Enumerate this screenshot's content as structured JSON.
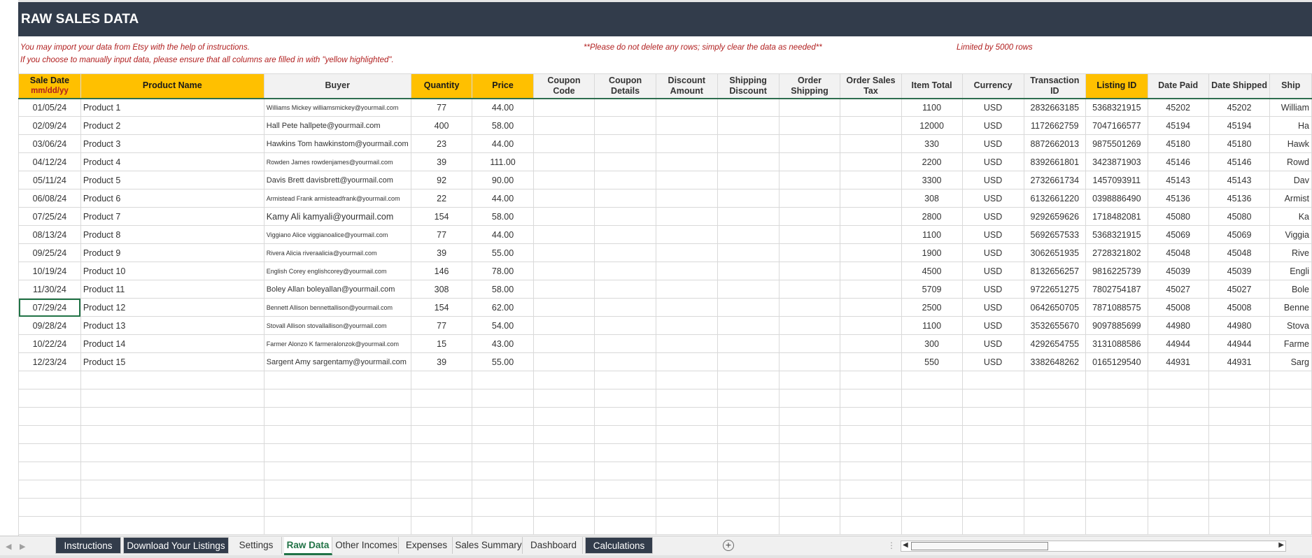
{
  "title": "RAW SALES DATA",
  "notes": {
    "line1": "You may import your data from Etsy with the help of instructions.",
    "line2": "If you choose to manually input data, please ensure that all columns are filled in with \"yellow highlighted\".",
    "warning": "**Please do not delete any rows; simply clear the data as needed**",
    "limit": "Limited by 5000 rows"
  },
  "columns": [
    {
      "label": "Sale Date",
      "sub": "mm/dd/yy",
      "yellow": true
    },
    {
      "label": "Product Name",
      "yellow": true
    },
    {
      "label": "Buyer",
      "yellow": false
    },
    {
      "label": "Quantity",
      "yellow": true
    },
    {
      "label": "Price",
      "yellow": true
    },
    {
      "label": "Coupon Code",
      "yellow": false
    },
    {
      "label": "Coupon Details",
      "yellow": false
    },
    {
      "label": "Discount Amount",
      "yellow": false
    },
    {
      "label": "Shipping Discount",
      "yellow": false
    },
    {
      "label": "Order Shipping",
      "yellow": false
    },
    {
      "label": "Order Sales Tax",
      "yellow": false
    },
    {
      "label": "Item Total",
      "yellow": false
    },
    {
      "label": "Currency",
      "yellow": false
    },
    {
      "label": "Transaction ID",
      "yellow": false
    },
    {
      "label": "Listing ID",
      "yellow": true
    },
    {
      "label": "Date Paid",
      "yellow": false
    },
    {
      "label": "Date Shipped",
      "yellow": false
    },
    {
      "label": "Ship",
      "yellow": false
    }
  ],
  "rows": [
    {
      "date": "01/05/24",
      "product": "Product 1",
      "buyer": "Williams Mickey williamsmickey@yourmail.com",
      "qty": "77",
      "price": "44.00",
      "total": "1100",
      "currency": "USD",
      "txn": "2832663185",
      "listing": "5368321915",
      "paid": "45202",
      "shipped": "45202",
      "ship": "William"
    },
    {
      "date": "02/09/24",
      "product": "Product 2",
      "buyer": "Hall Pete hallpete@yourmail.com",
      "qty": "400",
      "price": "58.00",
      "total": "12000",
      "currency": "USD",
      "txn": "1172662759",
      "listing": "7047166577",
      "paid": "45194",
      "shipped": "45194",
      "ship": "Ha"
    },
    {
      "date": "03/06/24",
      "product": "Product 3",
      "buyer": "Hawkins Tom hawkinstom@yourmail.com",
      "qty": "23",
      "price": "44.00",
      "total": "330",
      "currency": "USD",
      "txn": "8872662013",
      "listing": "9875501269",
      "paid": "45180",
      "shipped": "45180",
      "ship": "Hawk"
    },
    {
      "date": "04/12/24",
      "product": "Product 4",
      "buyer": "Rowden James rowdenjames@yourmail.com",
      "qty": "39",
      "price": "111.00",
      "total": "2200",
      "currency": "USD",
      "txn": "8392661801",
      "listing": "3423871903",
      "paid": "45146",
      "shipped": "45146",
      "ship": "Rowd"
    },
    {
      "date": "05/11/24",
      "product": "Product 5",
      "buyer": "Davis Brett davisbrett@yourmail.com",
      "qty": "92",
      "price": "90.00",
      "total": "3300",
      "currency": "USD",
      "txn": "2732661734",
      "listing": "1457093911",
      "paid": "45143",
      "shipped": "45143",
      "ship": "Dav"
    },
    {
      "date": "06/08/24",
      "product": "Product 6",
      "buyer": "Armistead Frank armisteadfrank@yourmail.com",
      "qty": "22",
      "price": "44.00",
      "total": "308",
      "currency": "USD",
      "txn": "6132661220",
      "listing": "0398886490",
      "paid": "45136",
      "shipped": "45136",
      "ship": "Armist"
    },
    {
      "date": "07/25/24",
      "product": "Product 7",
      "buyer": "Kamy Ali kamyali@yourmail.com",
      "qty": "154",
      "price": "58.00",
      "total": "2800",
      "currency": "USD",
      "txn": "9292659626",
      "listing": "1718482081",
      "paid": "45080",
      "shipped": "45080",
      "ship": "Ka"
    },
    {
      "date": "08/13/24",
      "product": "Product 8",
      "buyer": "Viggiano Alice viggianoalice@yourmail.com",
      "qty": "77",
      "price": "44.00",
      "total": "1100",
      "currency": "USD",
      "txn": "5692657533",
      "listing": "5368321915",
      "paid": "45069",
      "shipped": "45069",
      "ship": "Viggia"
    },
    {
      "date": "09/25/24",
      "product": "Product 9",
      "buyer": "Rivera Alicia riveraalicia@yourmail.com",
      "qty": "39",
      "price": "55.00",
      "total": "1900",
      "currency": "USD",
      "txn": "3062651935",
      "listing": "2728321802",
      "paid": "45048",
      "shipped": "45048",
      "ship": "Rive"
    },
    {
      "date": "10/19/24",
      "product": "Product 10",
      "buyer": "English Corey englishcorey@yourmail.com",
      "qty": "146",
      "price": "78.00",
      "total": "4500",
      "currency": "USD",
      "txn": "8132656257",
      "listing": "9816225739",
      "paid": "45039",
      "shipped": "45039",
      "ship": "Engli"
    },
    {
      "date": "11/30/24",
      "product": "Product 11",
      "buyer": "Boley Allan boleyallan@yourmail.com",
      "qty": "308",
      "price": "58.00",
      "total": "5709",
      "currency": "USD",
      "txn": "9722651275",
      "listing": "7802754187",
      "paid": "45027",
      "shipped": "45027",
      "ship": "Bole"
    },
    {
      "date": "07/29/24",
      "product": "Product 12",
      "buyer": "Bennett Allison bennettallison@yourmail.com",
      "qty": "154",
      "price": "62.00",
      "total": "2500",
      "currency": "USD",
      "txn": "0642650705",
      "listing": "7871088575",
      "paid": "45008",
      "shipped": "45008",
      "ship": "Benne"
    },
    {
      "date": "09/28/24",
      "product": "Product 13",
      "buyer": "Stovall Allison stovallallison@yourmail.com",
      "qty": "77",
      "price": "54.00",
      "total": "1100",
      "currency": "USD",
      "txn": "3532655670",
      "listing": "9097885699",
      "paid": "44980",
      "shipped": "44980",
      "ship": "Stova"
    },
    {
      "date": "10/22/24",
      "product": "Product 14",
      "buyer": "Farmer Alonzo K farmeralonzok@yourmail.com",
      "qty": "15",
      "price": "43.00",
      "total": "300",
      "currency": "USD",
      "txn": "4292654755",
      "listing": "3131088586",
      "paid": "44944",
      "shipped": "44944",
      "ship": "Farme"
    },
    {
      "date": "12/23/24",
      "product": "Product 15",
      "buyer": "Sargent Amy sargentamy@yourmail.com",
      "qty": "39",
      "price": "55.00",
      "total": "550",
      "currency": "USD",
      "txn": "3382648262",
      "listing": "0165129540",
      "paid": "44931",
      "shipped": "44931",
      "ship": "Sarg"
    }
  ],
  "tabs": [
    {
      "label": "Instructions",
      "style": "dark"
    },
    {
      "label": "Download Your Listings",
      "style": "dark"
    },
    {
      "label": "Settings",
      "style": "plain"
    },
    {
      "label": "Raw Data",
      "style": "active"
    },
    {
      "label": "Other Incomes",
      "style": "plain"
    },
    {
      "label": "Expenses",
      "style": "plain"
    },
    {
      "label": "Sales Summary",
      "style": "plain"
    },
    {
      "label": "Dashboard",
      "style": "plain"
    },
    {
      "label": "Calculations",
      "style": "dark"
    }
  ],
  "selected_cell": {
    "row": 11,
    "column": "Sale Date"
  },
  "colors": {
    "title_bg": "#323c4b",
    "yellow_header": "#ffc000",
    "note_red": "#b11f1f",
    "active_tab": "#217346"
  }
}
